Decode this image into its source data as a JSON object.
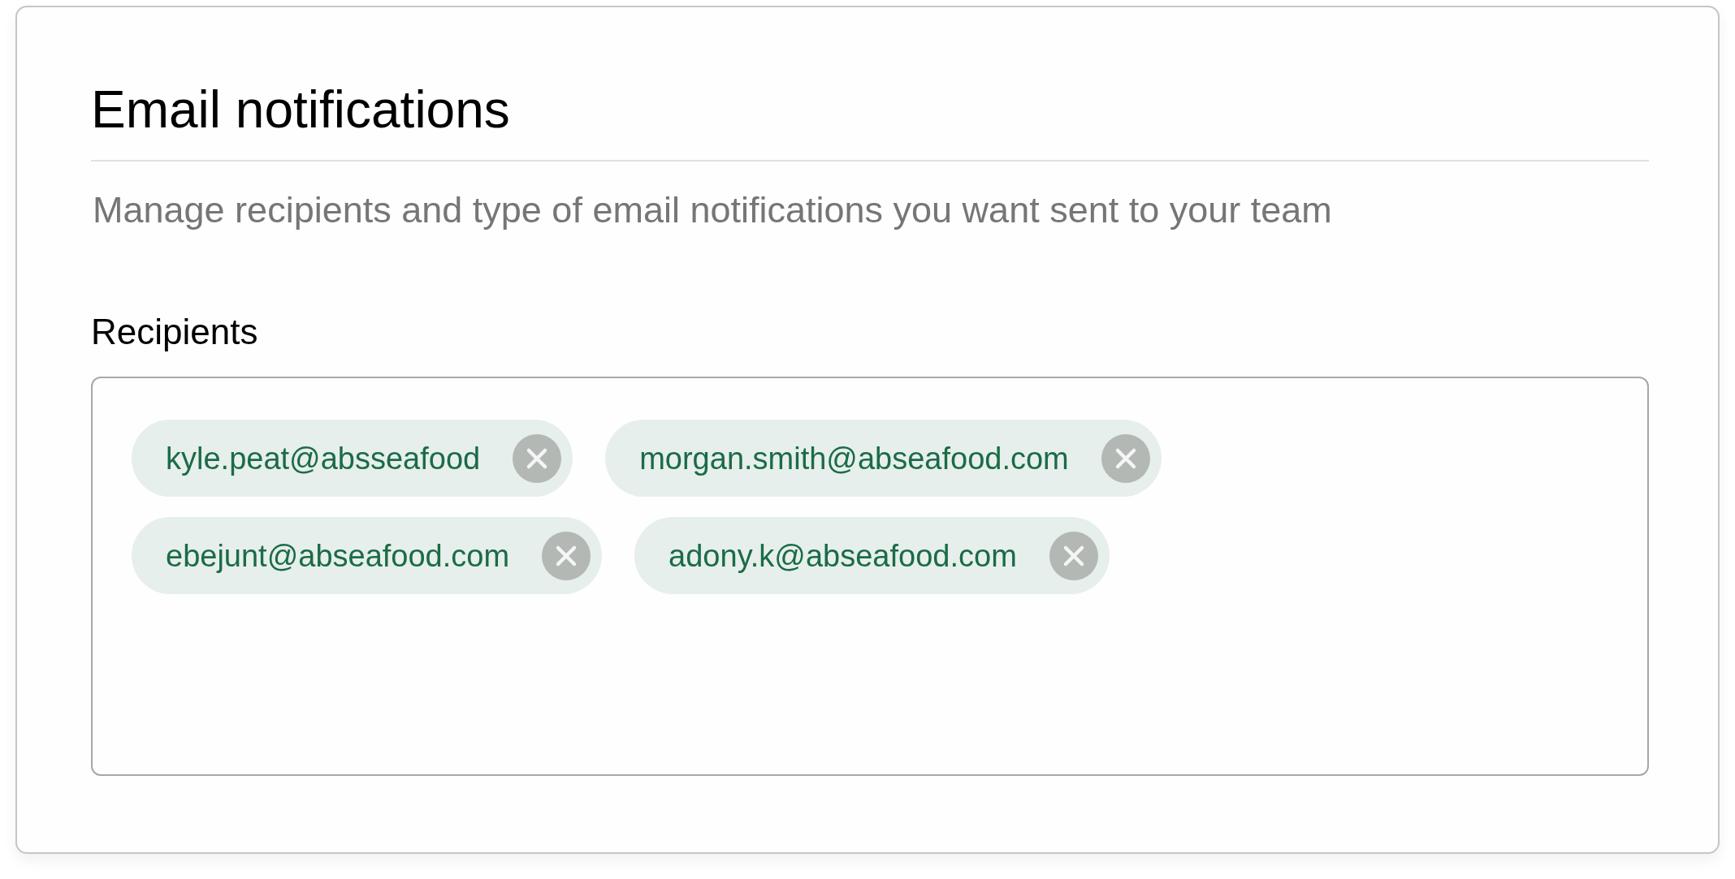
{
  "section": {
    "title": "Email notifications",
    "description": "Manage recipients and type of email notifications you want sent to your team"
  },
  "recipients": {
    "label": "Recipients",
    "chips": [
      {
        "email": "kyle.peat@absseafood"
      },
      {
        "email": "morgan.smith@abseafood.com"
      },
      {
        "email": "ebejunt@abseafood.com"
      },
      {
        "email": "adony.k@abseafood.com"
      }
    ]
  }
}
